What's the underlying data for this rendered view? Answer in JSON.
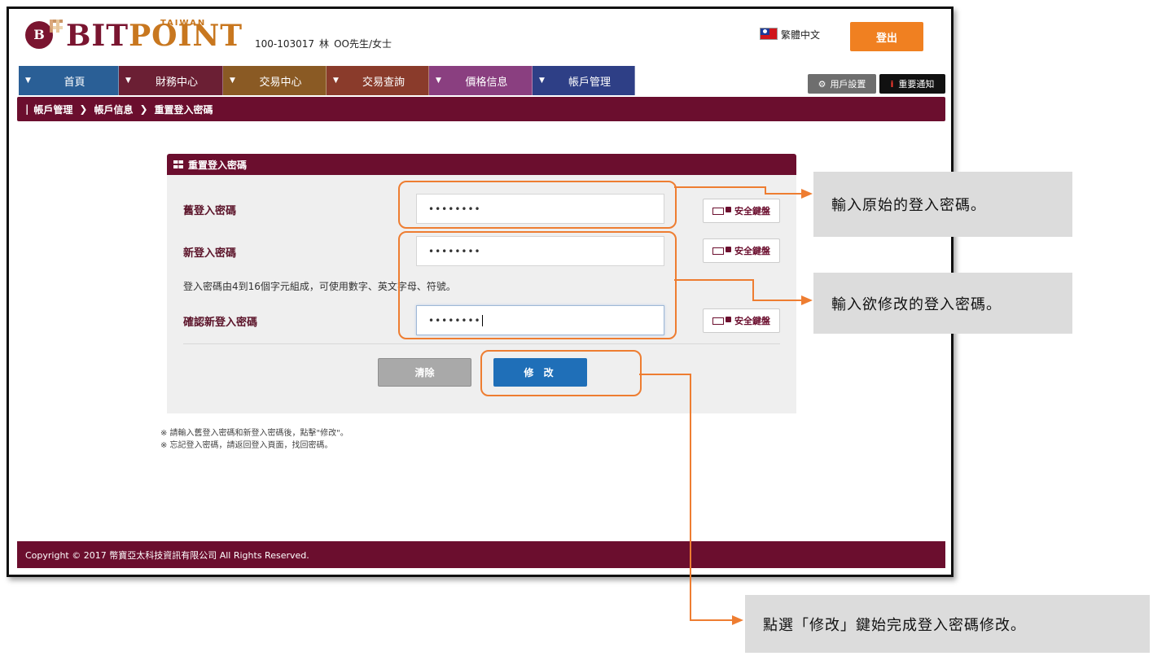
{
  "header": {
    "logo_bit": "BIT",
    "logo_point": "POINT",
    "logo_taiwan": "TAIWAN",
    "logo_mark": "B",
    "account_id": "100-103017",
    "account_name": "林",
    "account_title": "OO先生/女士",
    "language": "繁體中文",
    "logout_label": "登出"
  },
  "nav": {
    "items": [
      {
        "label": "首頁"
      },
      {
        "label": "財務中心"
      },
      {
        "label": "交易中心"
      },
      {
        "label": "交易查詢"
      },
      {
        "label": "價格信息"
      },
      {
        "label": "帳戶管理"
      }
    ],
    "user_settings": "用戶設置",
    "notice": "重要通知",
    "notice_icon": "i"
  },
  "breadcrumb": {
    "items": [
      "帳戶管理",
      "帳戶信息",
      "重置登入密碼"
    ]
  },
  "panel": {
    "title": "重置登入密碼",
    "old_label": "舊登入密碼",
    "old_value": "••••••••",
    "new_label": "新登入密碼",
    "new_value": "••••••••",
    "hint": "登入密碼由4到16個字元組成，可使用數字、英文字母、符號。",
    "confirm_label": "確認新登入密碼",
    "confirm_value": "••••••••",
    "keyboard_label": "安全鍵盤",
    "clear_label": "清除",
    "modify_label": "修 改"
  },
  "notes": [
    "※ 請輸入舊登入密碼和新登入密碼後，點擊\"修改\"。",
    "※ 忘記登入密碼，請返回登入頁面，找回密碼。"
  ],
  "footer": {
    "copyright": "Copyright © 2017 幣寶亞太科技資訊有限公司 All Rights Reserved."
  },
  "annotations": {
    "callout_1": "輸入原始的登入密碼。",
    "callout_2": "輸入欲修改的登入密碼。",
    "callout_3": "點選「修改」鍵始完成登入密碼修改。",
    "accent_color": "#ee7d31"
  },
  "colors": {
    "brand_maroon": "#6b0e2e",
    "brand_orange": "#f08021",
    "modify_blue": "#1f6fb8"
  }
}
